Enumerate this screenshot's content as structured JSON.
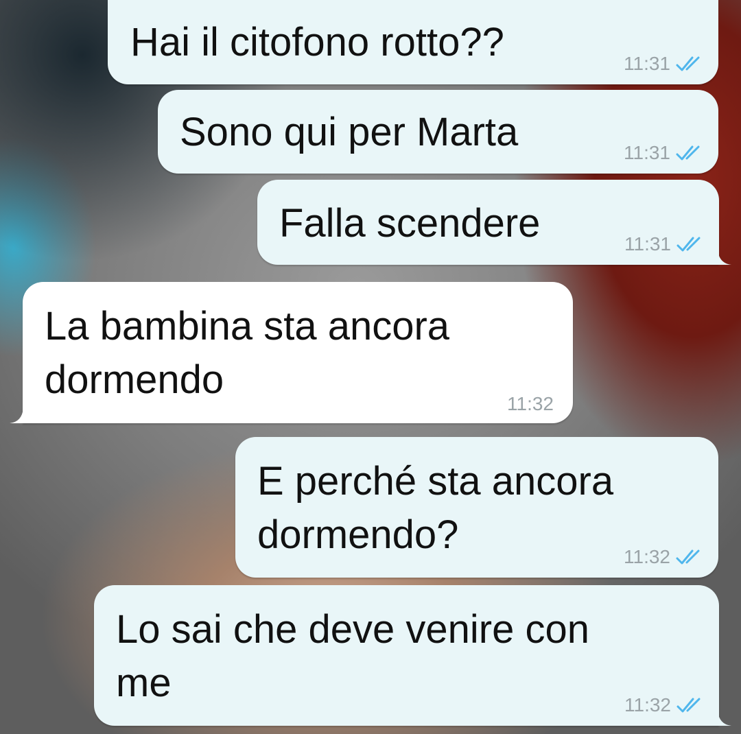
{
  "colors": {
    "outgoing_bubble": "#e9f6f8",
    "incoming_bubble": "#ffffff",
    "timestamp": "#9aa3a7",
    "read_tick": "#4fb6ec"
  },
  "messages": [
    {
      "direction": "outgoing",
      "text": "Hai il citofono rotto??",
      "time": "11:31",
      "status_icon": "double-check-icon"
    },
    {
      "direction": "outgoing",
      "text": "Sono qui per Marta",
      "time": "11:31",
      "status_icon": "double-check-icon"
    },
    {
      "direction": "outgoing",
      "text": "Falla scendere",
      "time": "11:31",
      "status_icon": "double-check-icon"
    },
    {
      "direction": "incoming",
      "line1": "La bambina sta ancora",
      "line2": "dormendo",
      "time": "11:32"
    },
    {
      "direction": "outgoing",
      "line1": "E perché sta ancora",
      "line2": "dormendo?",
      "time": "11:32",
      "status_icon": "double-check-icon"
    },
    {
      "direction": "outgoing",
      "line1": "Lo sai che deve venire con",
      "line2": "me",
      "time": "11:32",
      "status_icon": "double-check-icon"
    }
  ]
}
